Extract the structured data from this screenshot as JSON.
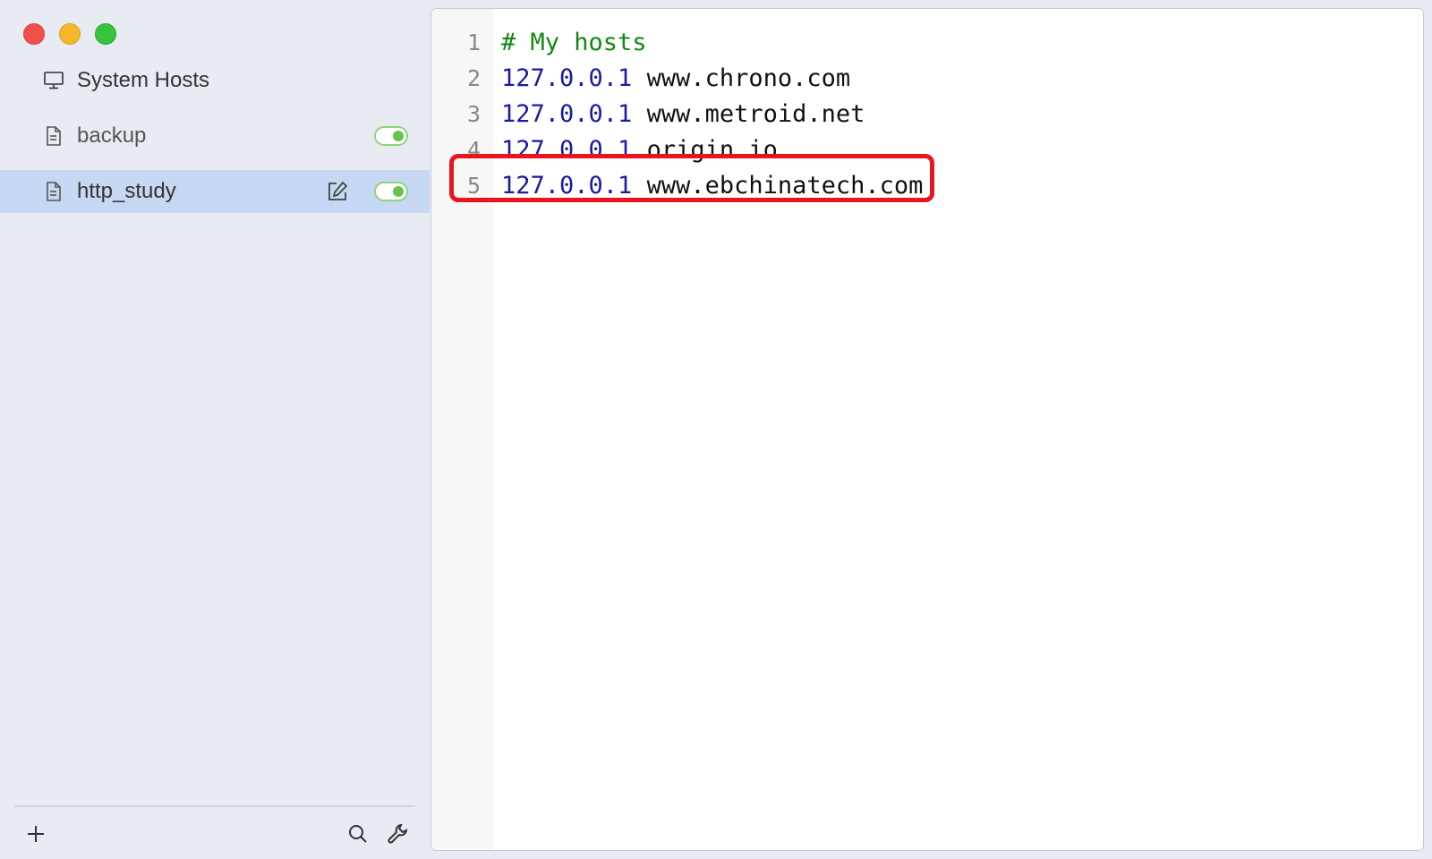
{
  "window": {
    "controls": [
      "close",
      "minimize",
      "maximize"
    ]
  },
  "sidebar": {
    "items": [
      {
        "label": "System Hosts",
        "icon": "monitor-icon"
      },
      {
        "label": "backup",
        "icon": "document-icon",
        "enabled": true
      },
      {
        "label": "http_study",
        "icon": "document-icon",
        "enabled": true,
        "selected": true
      }
    ],
    "toolbar": {
      "add_icon": "plus-icon",
      "search_icon": "search-icon",
      "settings_icon": "wrench-icon"
    }
  },
  "editor": {
    "lines": [
      {
        "num": "1",
        "comment": "# My hosts",
        "ip": "",
        "host": ""
      },
      {
        "num": "2",
        "comment": "",
        "ip": "127.0.0.1",
        "host": "www.chrono.com"
      },
      {
        "num": "3",
        "comment": "",
        "ip": "127.0.0.1",
        "host": "www.metroid.net"
      },
      {
        "num": "4",
        "comment": "",
        "ip": "127.0.0.1",
        "host": "origin.io"
      },
      {
        "num": "5",
        "comment": "",
        "ip": "127.0.0.1",
        "host": "www.ebchinatech.com"
      }
    ],
    "highlighted_line": 5
  },
  "colors": {
    "sidebar_bg": "#e8ebf2",
    "selected_bg": "#c6d8f3",
    "toggle_on": "#6cc04f",
    "comment": "#118811",
    "ip": "#1a1aa6",
    "highlight": "#e8141e"
  }
}
